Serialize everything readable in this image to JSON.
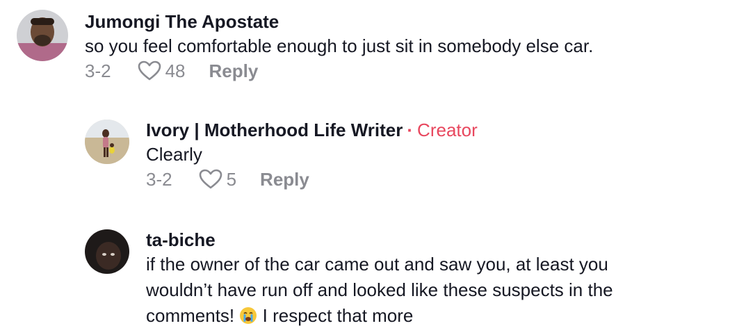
{
  "comments": [
    {
      "username": "Jumongi The Apostate",
      "text": "so you feel comfortable enough to just sit in somebody else car.",
      "date": "3-2",
      "likes": "48",
      "reply_label": "Reply"
    },
    {
      "username": "Ivory | Motherhood Life Writer",
      "badge_separator": "·",
      "badge": "Creator",
      "text": "Clearly",
      "date": "3-2",
      "likes": "5",
      "reply_label": "Reply"
    },
    {
      "username": "ta-biche",
      "text_line1": "if the owner of the car came out and saw you, at least you",
      "text_line2": "wouldn’t have run off and looked like these suspects in the",
      "text_line3_before": "comments!",
      "text_line3_after": "I respect that more",
      "emoji": "loudly-crying-face"
    }
  ],
  "colors": {
    "creator": "#e8475e",
    "meta": "#8a8b91",
    "text": "#161823"
  }
}
